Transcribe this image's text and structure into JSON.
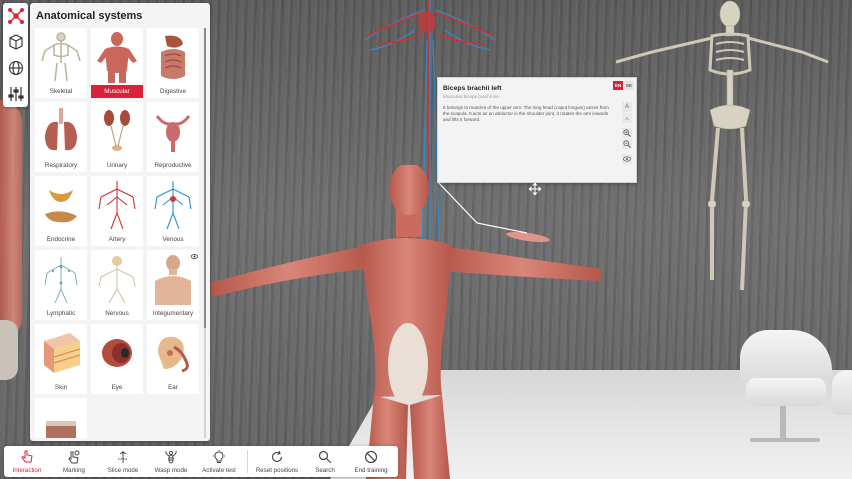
{
  "panel": {
    "title": "Anatomical systems",
    "systems": [
      {
        "label": "Skeletal"
      },
      {
        "label": "Muscular",
        "selected": true
      },
      {
        "label": "Digestive"
      },
      {
        "label": "Respiratory"
      },
      {
        "label": "Urinary"
      },
      {
        "label": "Reproductive"
      },
      {
        "label": "Endocrine"
      },
      {
        "label": "Artery"
      },
      {
        "label": "Venous"
      },
      {
        "label": "Lymphatic"
      },
      {
        "label": "Nervous"
      },
      {
        "label": "Integumentary"
      },
      {
        "label": "Skin"
      },
      {
        "label": "Eye"
      },
      {
        "label": "Ear"
      },
      {
        "label": ""
      }
    ]
  },
  "side_tools": [
    "interaction-hub-icon",
    "cube-icon",
    "globe-icon",
    "sliders-icon"
  ],
  "info_card": {
    "title": "Biceps brachii left",
    "latin": "Musculus biceps brachii sin.",
    "description": "It belongs to muscles of the upper arm. The long head (caput longum) arises from the scapula. It acts as an abductor in the shoulder joint, it rotates the arm inwards and lifts it forward.",
    "lang_en": "EN",
    "lang_sk": "SK"
  },
  "toolbar": {
    "items": [
      {
        "label": "Interaction",
        "active": true
      },
      {
        "label": "Marking"
      },
      {
        "label": "Slice mode"
      },
      {
        "label": "Wasp mode"
      },
      {
        "label": "Activate test"
      },
      {
        "label": "Reset positions"
      },
      {
        "label": "Search"
      },
      {
        "label": "End training"
      }
    ]
  },
  "colors": {
    "accent": "#d7223a",
    "panel_bg": "#f4f4f4",
    "muscle": "#c9675a",
    "bone": "#d8d2c2"
  }
}
